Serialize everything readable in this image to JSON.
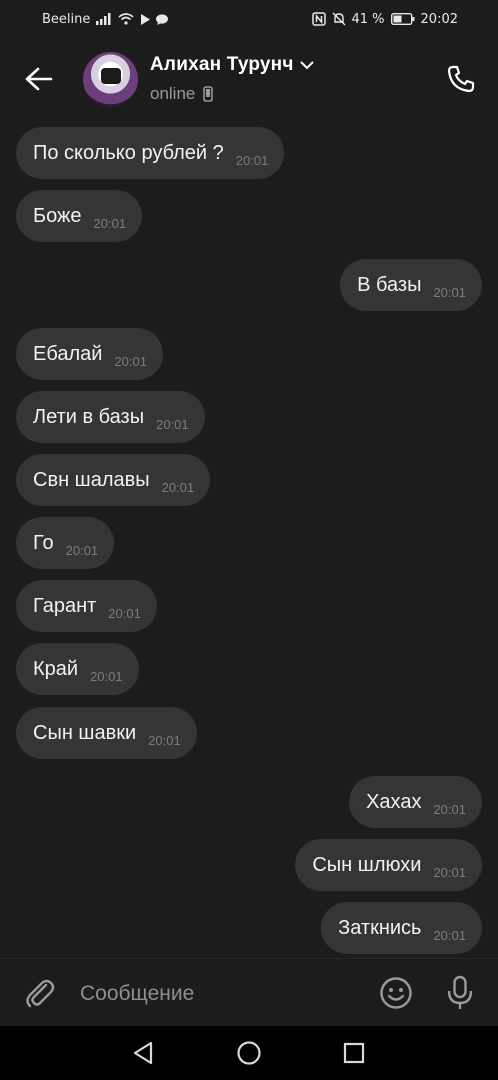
{
  "status_bar": {
    "carrier": "Beeline",
    "battery": "41 %",
    "time": "20:02"
  },
  "header": {
    "contact_name": "Алихан Турунч",
    "contact_status": "online"
  },
  "messages": [
    {
      "dir": "in",
      "text": "По сколько рублей ?",
      "time": "20:01"
    },
    {
      "dir": "in",
      "text": "Боже",
      "time": "20:01"
    },
    {
      "dir": "out",
      "text": "В базы",
      "time": "20:01"
    },
    {
      "dir": "in",
      "text": "Ебалай",
      "time": "20:01"
    },
    {
      "dir": "in",
      "text": "Лети в базы",
      "time": "20:01"
    },
    {
      "dir": "in",
      "text": "Свн шалавы",
      "time": "20:01"
    },
    {
      "dir": "in",
      "text": "Го",
      "time": "20:01"
    },
    {
      "dir": "in",
      "text": "Гарант",
      "time": "20:01"
    },
    {
      "dir": "in",
      "text": "Край",
      "time": "20:01"
    },
    {
      "dir": "in",
      "text": "Сын шавки",
      "time": "20:01"
    },
    {
      "dir": "out",
      "text": "Хахах",
      "time": "20:01"
    },
    {
      "dir": "out",
      "text": "Сын шлюхи",
      "time": "20:01"
    },
    {
      "dir": "out",
      "text": "Заткнись",
      "time": "20:01"
    }
  ],
  "composer": {
    "placeholder": "Сообщение"
  },
  "icons": {
    "back": "arrow-left-icon",
    "chevron": "chevron-down-icon",
    "device": "phone-device-icon",
    "call": "phone-call-icon",
    "attach": "paperclip-icon",
    "emoji": "smiley-icon",
    "mic": "microphone-icon",
    "nav_back": "triangle-back-icon",
    "nav_home": "circle-home-icon",
    "nav_recents": "square-recents-icon"
  },
  "colors": {
    "background": "#1c1c1d",
    "bubble": "#353537",
    "text": "#f2f2f2",
    "time": "#7c7c80",
    "secondary": "#9a9a9e"
  }
}
